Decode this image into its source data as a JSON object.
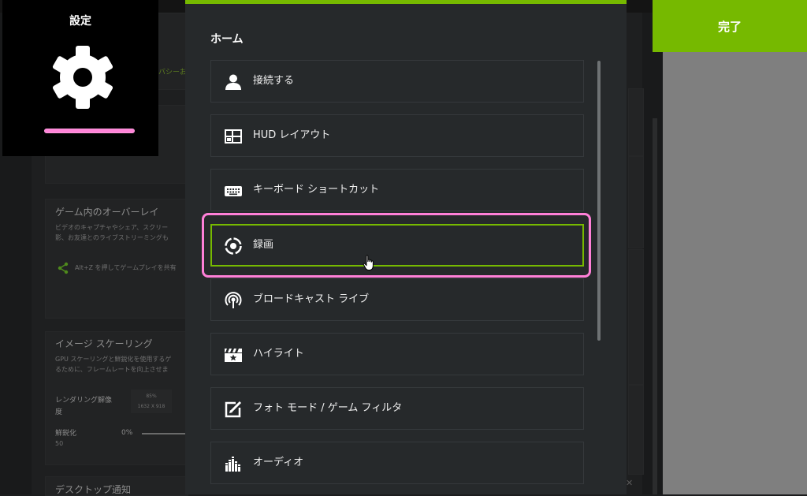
{
  "settings_tile": {
    "title": "設定",
    "icon": "gear-icon"
  },
  "done_button": {
    "label": "完了"
  },
  "dialog": {
    "heading": "ホーム",
    "items": [
      {
        "label": "接続する",
        "icon": "person-icon"
      },
      {
        "label": "HUD レイアウト",
        "icon": "layout-icon"
      },
      {
        "label": "キーボード ショートカット",
        "icon": "keyboard-icon"
      },
      {
        "label": "録画",
        "icon": "record-icon",
        "selected": true
      },
      {
        "label": "ブロードキャスト ライブ",
        "icon": "broadcast-icon"
      },
      {
        "label": "ハイライト",
        "icon": "clapperboard-star-icon"
      },
      {
        "label": "フォト モード / ゲーム フィルタ",
        "icon": "photo-edit-icon"
      },
      {
        "label": "オーディオ",
        "icon": "audio-levels-icon"
      }
    ]
  },
  "background": {
    "privacy_fragment": "バシーお",
    "overlay": {
      "title": "ゲーム内のオーバーレイ",
      "desc_line1": "ビデオのキャプチャやシェア、スクリー",
      "desc_line2": "影、お友達とのライブストリーミングも",
      "share_hint": "Alt+Z を押してゲームプレイを共有"
    },
    "scaling": {
      "title": "イメージ スケーリング",
      "desc_line1": "GPU スケーリングと鮮鋭化を使用するゲ",
      "desc_line2": "るために、フレームレートを向上させま",
      "render_label_1": "レンダリング解像",
      "render_label_2": "度",
      "render_pct": "85%",
      "render_res": "1632 X 918",
      "sharpen_label": "鮮鋭化",
      "sharpen_value": "50",
      "sharpen_pct": "0%"
    },
    "desktop_notify": "デスクトップ通知"
  },
  "colors": {
    "accent": "#76b900",
    "highlight": "#ff80d8"
  }
}
